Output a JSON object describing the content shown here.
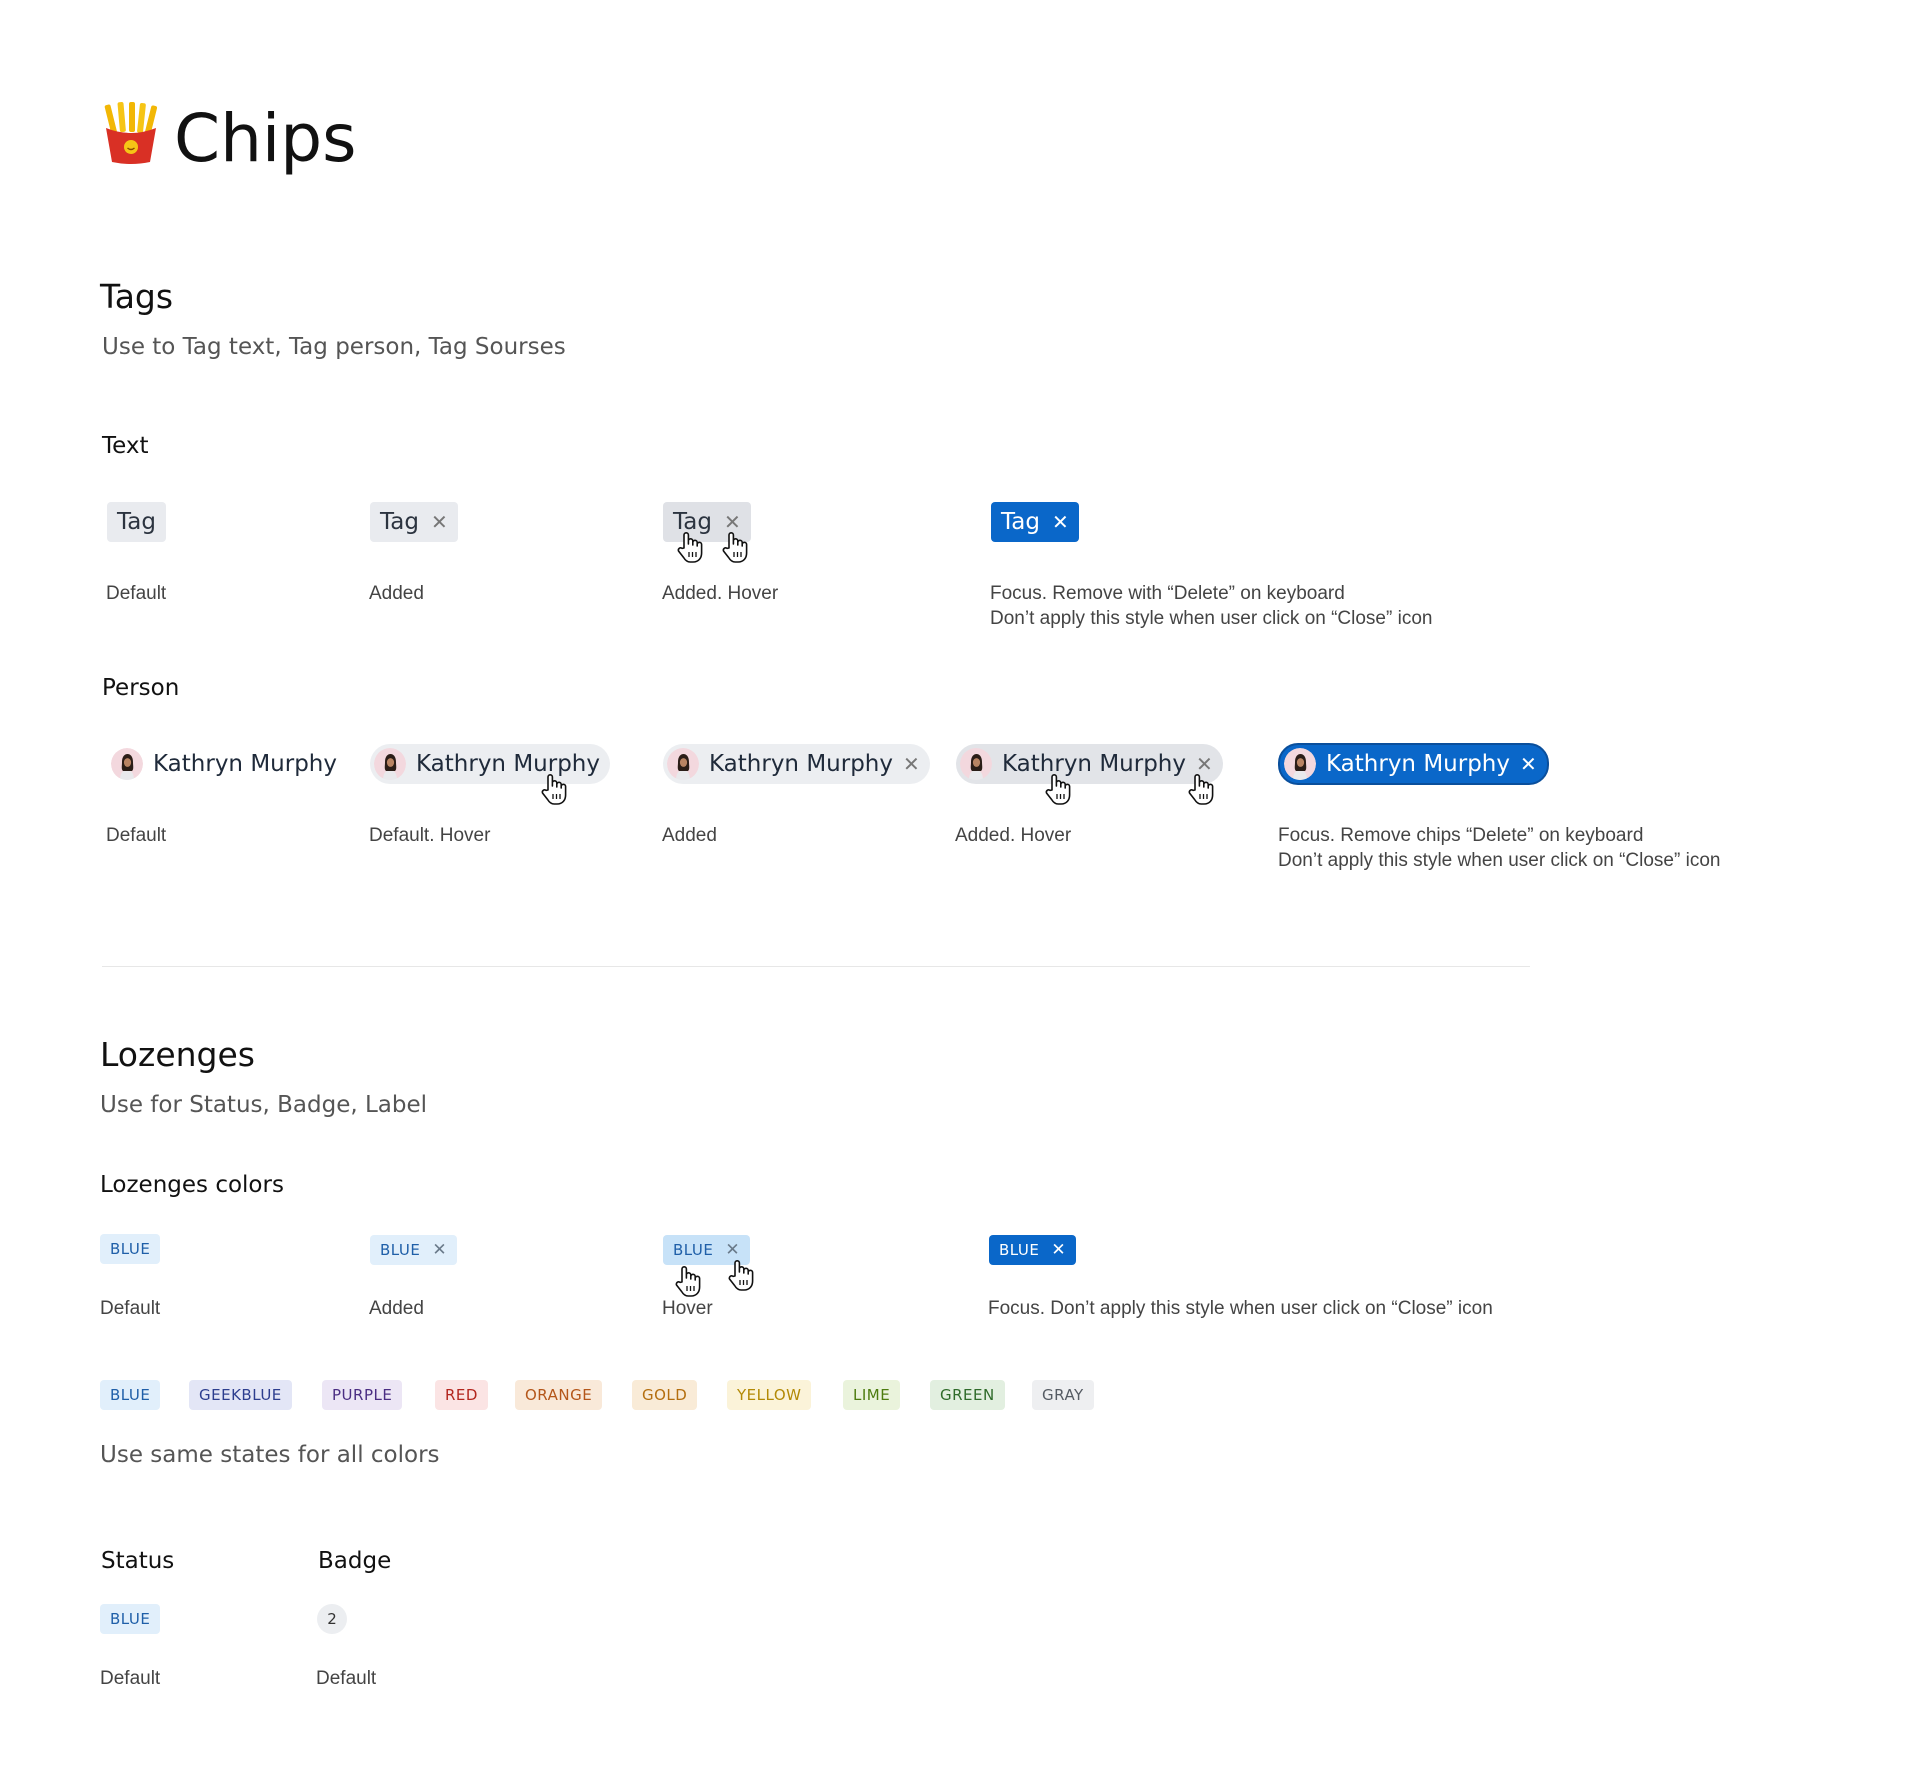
{
  "page_title": "Chips",
  "tags_section": {
    "title": "Tags",
    "subtitle": "Use to Tag text, Tag person, Tag Sourses",
    "text_group": {
      "heading": "Text",
      "chip_label": "Tag",
      "captions": {
        "default": "Default",
        "added": "Added",
        "added_hover": "Added. Hover",
        "focus_line1": "Focus. Remove with “Delete” on keyboard",
        "focus_line2": "Don’t apply this style when user click on “Close” icon"
      }
    },
    "person_group": {
      "heading": "Person",
      "person_name": "Kathryn Murphy",
      "captions": {
        "default": "Default",
        "default_hover": "Default. Hover",
        "added": "Added",
        "added_hover": "Added. Hover",
        "focus_line1": "Focus. Remove chips “Delete” on keyboard",
        "focus_line2": "Don’t apply this style when user click on “Close” icon"
      }
    }
  },
  "lozenges_section": {
    "title": "Lozenges",
    "subtitle": "Use for Status, Badge, Label",
    "colors_group": {
      "heading": "Lozenges colors",
      "chip_label": "BLUE",
      "captions": {
        "default": "Default",
        "added": "Added",
        "hover": "Hover",
        "focus": "Focus. Don’t apply this style when user click on “Close” icon"
      }
    },
    "palette": [
      {
        "label": "BLUE",
        "bg": "#e1effb",
        "fg": "#1f5fa8"
      },
      {
        "label": "GEEKBLUE",
        "bg": "#e3e6f6",
        "fg": "#2d3e8f"
      },
      {
        "label": "PURPLE",
        "bg": "#ece6f5",
        "fg": "#4b2e83"
      },
      {
        "label": "RED",
        "bg": "#fbe4e4",
        "fg": "#b3261e"
      },
      {
        "label": "ORANGE",
        "bg": "#f9e9d9",
        "fg": "#b4561a"
      },
      {
        "label": "GOLD",
        "bg": "#f9ebd7",
        "fg": "#b46e0e"
      },
      {
        "label": "YELLOW",
        "bg": "#fbf3d9",
        "fg": "#b38a06"
      },
      {
        "label": "LIME",
        "bg": "#eaf3dc",
        "fg": "#4d7c0f"
      },
      {
        "label": "GREEN",
        "bg": "#e2efe0",
        "fg": "#2f6b2a"
      },
      {
        "label": "GRAY",
        "bg": "#eeeff1",
        "fg": "#555b63"
      }
    ],
    "palette_note": "Use same states for all colors",
    "status": {
      "heading": "Status",
      "label": "BLUE",
      "caption": "Default"
    },
    "badge": {
      "heading": "Badge",
      "value": "2",
      "caption": "Default"
    }
  },
  "colors": {
    "focus_blue": "#0a67c9",
    "tag_bg": "#e9ebef",
    "lozenge_blue_bg": "#e1effb",
    "lozenge_blue_hover_bg": "#c7e2f8",
    "lozenge_blue_fg": "#1f5fa8"
  },
  "icons": {
    "title": "french-fries-icon",
    "close": "close-icon",
    "cursor": "hand-pointer-cursor-icon",
    "avatar": "person-avatar"
  }
}
